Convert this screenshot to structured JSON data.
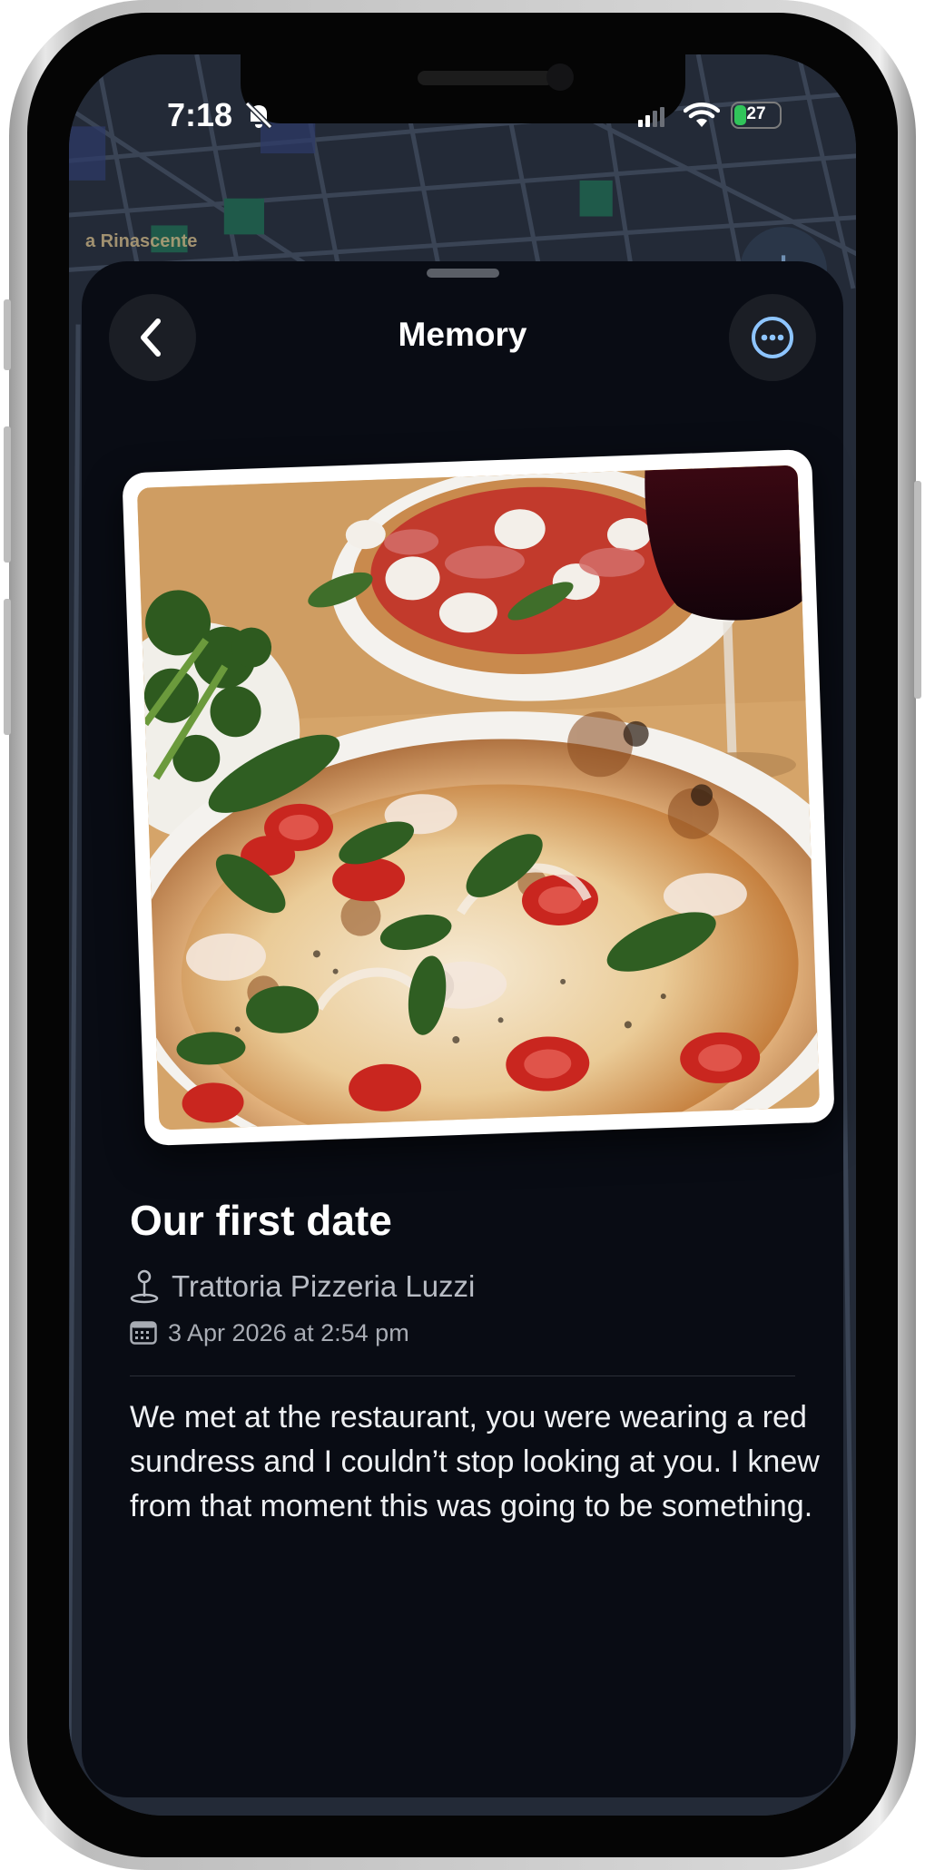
{
  "status_bar": {
    "time": "7:18",
    "battery": "27",
    "battery_level": 0.27
  },
  "map": {
    "label": "a Rinascente",
    "add_icon": "plus-icon"
  },
  "sheet": {
    "title": "Memory",
    "back_icon": "chevron-left-icon",
    "more_icon": "ellipsis-circle-icon",
    "accent": "#8ec5ff"
  },
  "memory": {
    "title": "Our first date",
    "location_icon": "map-pin-icon",
    "location": "Trattoria Pizzeria Luzzi",
    "date_icon": "calendar-icon",
    "date": "3 Apr 2026 at 2:54 pm",
    "description": "We met at the restaurant, you were wearing a red sundress and I couldn’t stop looking at you. I knew from that moment this was going to be something."
  }
}
